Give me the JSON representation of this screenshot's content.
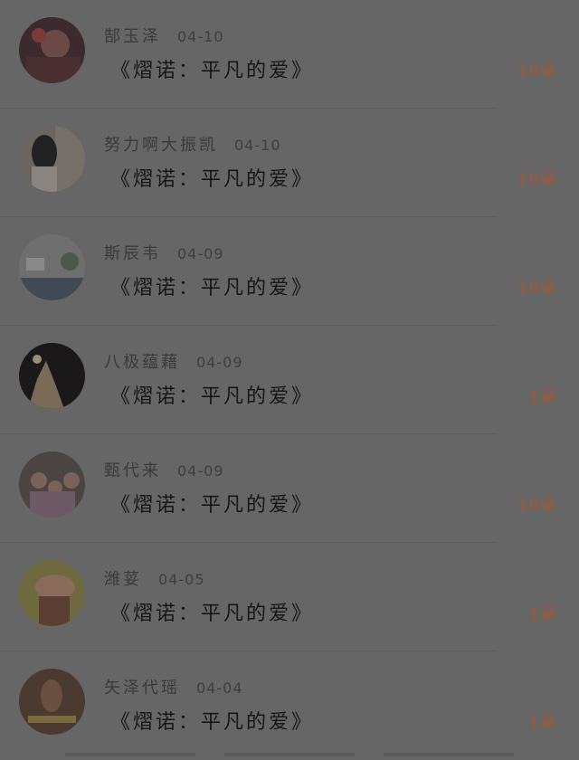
{
  "records": [
    {
      "name": "郜玉泽",
      "date": "04-10",
      "book": "《熠诺：平凡的爱》",
      "count": "10朵",
      "avatar": "avatar-1"
    },
    {
      "name": "努力啊大振凯",
      "date": "04-10",
      "book": "《熠诺：平凡的爱》",
      "count": "10朵",
      "avatar": "avatar-2"
    },
    {
      "name": "斯辰韦",
      "date": "04-09",
      "book": "《熠诺：平凡的爱》",
      "count": "10朵",
      "avatar": "avatar-3"
    },
    {
      "name": "八极蕴藉",
      "date": "04-09",
      "book": "《熠诺：平凡的爱》",
      "count": "1朵",
      "avatar": "avatar-4"
    },
    {
      "name": "甄代来",
      "date": "04-09",
      "book": "《熠诺：平凡的爱》",
      "count": "10朵",
      "avatar": "avatar-5"
    },
    {
      "name": "潍荽",
      "date": "04-05",
      "book": "《熠诺：平凡的爱》",
      "count": "1朵",
      "avatar": "avatar-6"
    },
    {
      "name": "矢泽代瑶",
      "date": "04-04",
      "book": "《熠诺：平凡的爱》",
      "count": "1朵",
      "avatar": "avatar-7"
    }
  ],
  "colors": {
    "overlay": "#666666",
    "count": "#a8542d"
  }
}
